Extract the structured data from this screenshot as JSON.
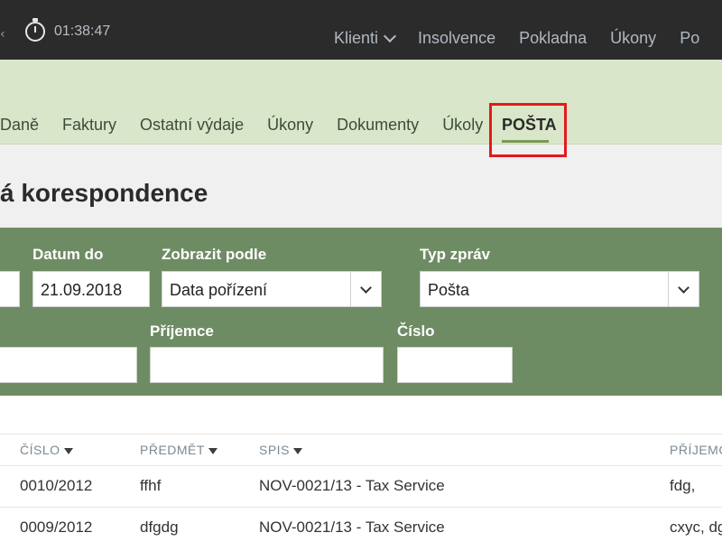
{
  "topbar": {
    "timer": "01:38:47",
    "nav": [
      {
        "label": "Klienti",
        "has_dropdown": true
      },
      {
        "label": "Insolvence"
      },
      {
        "label": "Pokladna"
      },
      {
        "label": "Úkony"
      },
      {
        "label": "Po"
      }
    ]
  },
  "tabs": {
    "items": [
      "Daně",
      "Faktury",
      "Ostatní výdaje",
      "Úkony",
      "Dokumenty",
      "Úkoly"
    ],
    "active": "POŠTA"
  },
  "page_title": "á korespondence",
  "filters": {
    "datum_do": {
      "label": "Datum do",
      "value": "21.09.2018"
    },
    "zobrazit_podle": {
      "label": "Zobrazit podle",
      "value": "Data pořízení"
    },
    "typ_zprav": {
      "label": "Typ zpráv",
      "value": "Pošta"
    },
    "prijemce": {
      "label": "Příjemce",
      "value": ""
    },
    "cislo": {
      "label": "Číslo",
      "value": ""
    }
  },
  "table": {
    "columns": [
      "ČÍSLO",
      "PŘEDMĚT",
      "SPIS",
      "PŘÍJEMC"
    ],
    "rows": [
      {
        "cislo": "0010/2012",
        "predmet": "ffhf",
        "spis": "NOV-0021/13 - Tax Service",
        "prijemce": "fdg,"
      },
      {
        "cislo": "0009/2012",
        "predmet": "dfgdg",
        "spis": "NOV-0021/13 - Tax Service",
        "prijemce": "cxyc, dg"
      }
    ]
  },
  "colors": {
    "topbar_bg": "#2b2b2b",
    "subnav_bg": "#d9e6c9",
    "filter_bg": "#6e8c63",
    "highlight": "#e21b1b",
    "accent": "#7b9a52"
  }
}
